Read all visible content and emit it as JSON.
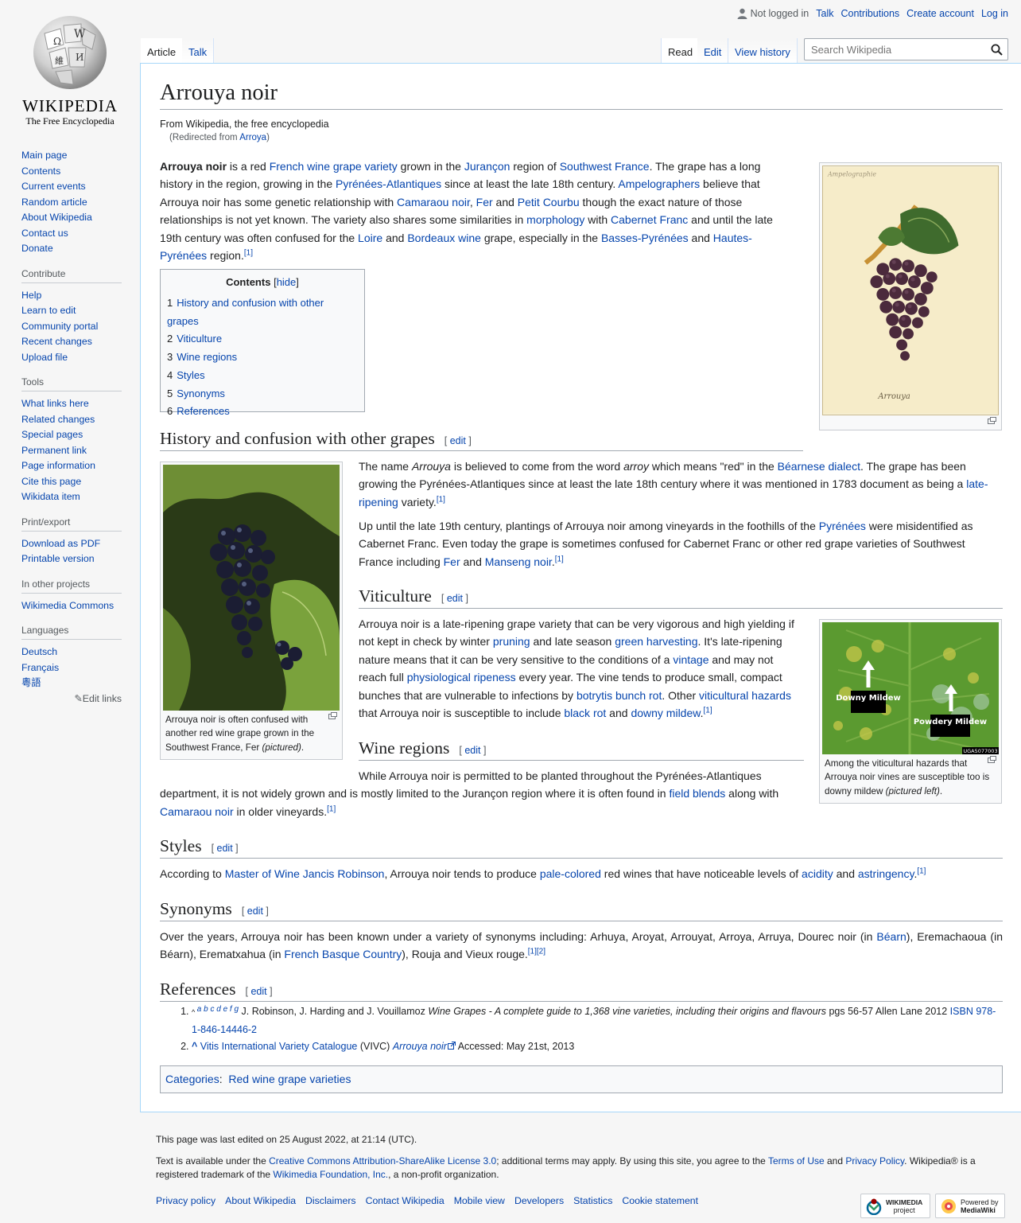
{
  "personal": {
    "not_logged_in": "Not logged in",
    "talk": "Talk",
    "contributions": "Contributions",
    "create_account": "Create account",
    "login": "Log in"
  },
  "logo": {
    "wordmark": "WIKIPEDIA",
    "tagline": "The Free Encyclopedia"
  },
  "sidebar": {
    "nav": [
      "Main page",
      "Contents",
      "Current events",
      "Random article",
      "About Wikipedia",
      "Contact us",
      "Donate"
    ],
    "contribute": {
      "title": "Contribute",
      "items": [
        "Help",
        "Learn to edit",
        "Community portal",
        "Recent changes",
        "Upload file"
      ]
    },
    "tools": {
      "title": "Tools",
      "items": [
        "What links here",
        "Related changes",
        "Special pages",
        "Permanent link",
        "Page information",
        "Cite this page",
        "Wikidata item"
      ]
    },
    "print": {
      "title": "Print/export",
      "items": [
        "Download as PDF",
        "Printable version"
      ]
    },
    "projects": {
      "title": "In other projects",
      "items": [
        "Wikimedia Commons"
      ]
    },
    "languages": {
      "title": "Languages",
      "items": [
        "Deutsch",
        "Français",
        "粵語"
      ],
      "edit": "Edit links"
    }
  },
  "tabs": {
    "article": "Article",
    "talk": "Talk",
    "read": "Read",
    "edit": "Edit",
    "history": "View history"
  },
  "search": {
    "placeholder": "Search Wikipedia"
  },
  "article": {
    "title": "Arrouya noir",
    "sitesub": "From Wikipedia, the free encyclopedia",
    "redirect_prefix": "(Redirected from ",
    "redirect_link": "Arroya",
    "redirect_suffix": ")",
    "edit_label": "edit"
  },
  "intro": {
    "t1": "Arrouya noir",
    "t2": " is a red ",
    "l1": "French wine grape variety",
    "t3": " grown in the ",
    "l2": "Jurançon",
    "t4": " region of ",
    "l3": "Southwest France",
    "t5": ". The grape has a long history in the region, growing in the ",
    "l4": "Pyrénées-Atlantiques",
    "t6": " since at least the late 18th century. ",
    "l5": "Ampelographers",
    "t7": " believe that Arrouya noir has some genetic relationship with ",
    "l6": "Camaraou noir",
    "t8": ", ",
    "l7": "Fer",
    "t9": " and ",
    "l8": "Petit Courbu",
    "t10": " though the exact nature of those relationships is not yet known. The variety also shares some similarities in ",
    "l9": "morphology",
    "t11": " with ",
    "l10": "Cabernet Franc",
    "t12": " and until the late 19th century was often confused for the ",
    "l11": "Loire",
    "t13": " and ",
    "l12": "Bordeaux wine",
    "t14": " grape, especially in the ",
    "l13": "Basses-Pyrénées",
    "t15": " and ",
    "l14": "Hautes-Pyrénées",
    "t16": " region.",
    "ref": "[1]"
  },
  "toc": {
    "title": "Contents",
    "hide": "hide",
    "items": [
      {
        "num": "1",
        "label": "History and confusion with other grapes"
      },
      {
        "num": "2",
        "label": "Viticulture"
      },
      {
        "num": "3",
        "label": "Wine regions"
      },
      {
        "num": "4",
        "label": "Styles"
      },
      {
        "num": "5",
        "label": "Synonyms"
      },
      {
        "num": "6",
        "label": "References"
      }
    ]
  },
  "history": {
    "heading": "History and confusion with other grapes",
    "p1": {
      "t1": "The name ",
      "i1": "Arrouya",
      "t2": " is believed to come from the word ",
      "i2": "arroy",
      "t3": " which means \"red\" in the ",
      "l1": "Béarnese dialect",
      "t4": ". The grape has been growing the Pyrénées-Atlantiques since at least the late 18th century where it was mentioned in 1783 document as being a ",
      "l2": "late-ripening",
      "t5": " variety.",
      "ref": "[1]"
    },
    "p2": {
      "t1": "Up until the late 19th century, plantings of Arrouya noir among vineyards in the foothills of the ",
      "l1": "Pyrénées",
      "t2": " were misidentified as Cabernet Franc. Even today the grape is sometimes confused for Cabernet Franc or other red grape varieties of Southwest France including ",
      "l2": "Fer",
      "t3": " and ",
      "l3": "Manseng noir",
      "t4": ".",
      "ref": "[1]"
    }
  },
  "fer_caption": {
    "text": "Arrouya noir is often confused with another red wine grape grown in the Southwest France, Fer ",
    "italic": "(pictured)",
    "end": "."
  },
  "plate_text": {
    "top": "Ampelographie",
    "name": "Arrouya"
  },
  "viticulture": {
    "heading": "Viticulture",
    "t1": "Arrouya noir is a late-ripening grape variety that can be very vigorous and high yielding if not kept in check by winter ",
    "l1": "pruning",
    "t2": " and late season ",
    "l2": "green harvesting",
    "t3": ". It's late-ripening nature means that it can be very sensitive to the conditions of a ",
    "l3": "vintage",
    "t4": " and may not reach full ",
    "l4": "physiological ripeness",
    "t5": " every year. The vine tends to produce small, compact bunches that are vulnerable to infections by ",
    "l5": "botrytis bunch rot",
    "t6": ". Other ",
    "l6": "viticultural hazards",
    "t7": " that Arrouya noir is susceptible to include ",
    "l7": "black rot",
    "t8": " and ",
    "l8": "downy mildew",
    "t9": ".",
    "ref": "[1]"
  },
  "mildew": {
    "label_downy": "Downy Mildew",
    "label_powdery": "Powdery Mildew",
    "code": "UGA5077003",
    "caption": "Among the viticultural hazards that Arrouya noir vines are susceptible too is downy mildew ",
    "italic": "(pictured left)",
    "end": "."
  },
  "regions": {
    "heading": "Wine regions",
    "t1": "While Arrouya noir is permitted to be planted throughout the Pyrénées-Atlantiques department, it is not widely grown and is mostly limited to the Jurançon region where it is often found in ",
    "l1": "field blends",
    "t2": " along with ",
    "l2": "Camaraou noir",
    "t3": " in older vineyards.",
    "ref": "[1]"
  },
  "styles": {
    "heading": "Styles",
    "t1": "According to ",
    "l1": "Master of Wine Jancis Robinson",
    "t2": ", Arrouya noir tends to produce ",
    "l2": "pale-colored",
    "t3": " red wines that have noticeable levels of ",
    "l3": "acidity",
    "t4": " and ",
    "l4": "astringency",
    "t5": ".",
    "ref": "[1]"
  },
  "synonyms": {
    "heading": "Synonyms",
    "t1": "Over the years, Arrouya noir has been known under a variety of synonyms including: Arhuya, Aroyat, Arrouyat, Arroya, Arruya, Dourec noir (in ",
    "l1": "Béarn",
    "t2": "), Eremachaoua (in Béarn), Erematxahua (in ",
    "l2": "French Basque Country",
    "t3": "), Rouja and Vieux rouge.",
    "ref1": "[1]",
    "ref2": "[2]"
  },
  "references": {
    "heading": "References",
    "r1": {
      "caret": "^",
      "letters": [
        "a",
        "b",
        "c",
        "d",
        "e",
        "f",
        "g"
      ],
      "t1": " J. Robinson, J. Harding and J. Vouillamoz ",
      "i1": "Wine Grapes - A complete guide to 1,368 vine varieties, including their origins and flavours",
      "t2": " pgs 56-57 Allen Lane 2012 ",
      "isbn": "ISBN 978-1-846-14446-2"
    },
    "r2": {
      "caret": "^",
      "l1": "Vitis International Variety Catalogue",
      "t1": " (VIVC) ",
      "l2": "Arrouya noir",
      "t2": " Accessed: May 21st, 2013"
    }
  },
  "categories": {
    "label": "Categories",
    "item": "Red wine grape varieties"
  },
  "footer": {
    "last_edited": "This page was last edited on 25 August 2022, at 21:14 (UTC).",
    "lic1": "Text is available under the ",
    "lic_link": "Creative Commons Attribution-ShareAlike License 3.0",
    "lic2": "; additional terms may apply. By using this site, you agree to the ",
    "terms": "Terms of Use",
    "lic3": " and ",
    "privacy": "Privacy Policy",
    "lic4": ". Wikipedia® is a registered trademark of the ",
    "wmf": "Wikimedia Foundation, Inc.",
    "lic5": ", a non-profit organization.",
    "links": [
      "Privacy policy",
      "About Wikipedia",
      "Disclaimers",
      "Contact Wikipedia",
      "Mobile view",
      "Developers",
      "Statistics",
      "Cookie statement"
    ],
    "badge1": {
      "top": "WIKIMEDIA",
      "bottom": "project"
    },
    "badge2": {
      "top": "Powered by",
      "bottom": "MediaWiki"
    }
  },
  "colors": {
    "link": "#0645ad",
    "border": "#a2a9b1",
    "content_border": "#a7d7f9"
  }
}
